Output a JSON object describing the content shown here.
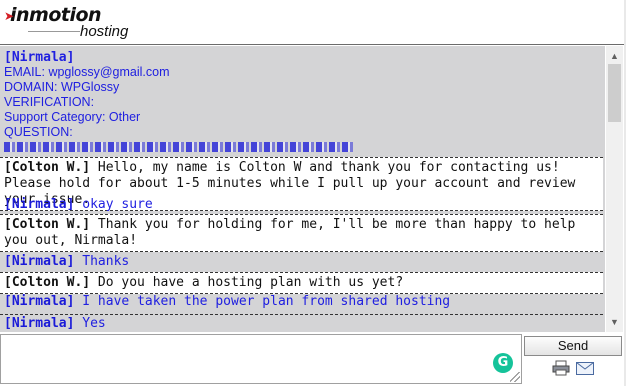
{
  "header": {
    "brand": "inmotion",
    "sub": "hosting"
  },
  "intro": {
    "who": "[Nirmala]",
    "email": "EMAIL: wpglossy@gmail.com",
    "domain": "DOMAIN: WPGlossy",
    "verification": "VERIFICATION:",
    "category": "Support Category: Other",
    "question_label": "QUESTION:"
  },
  "messages": [
    {
      "who": "[Colton W.]",
      "text": " Hello, my name is Colton W and thank you for contacting us! Please hold for about 1-5 minutes while I pull up your account and review your issue."
    },
    {
      "who": "[Nirmala]",
      "text": " okay sure"
    },
    {
      "who": "[Colton W.]",
      "text": " Thank you for holding for me, I'll be more than happy to help you out, Nirmala!"
    },
    {
      "who": "[Nirmala]",
      "text": " Thanks"
    },
    {
      "who": "[Colton W.]",
      "text": " Do you have a hosting plan with us yet?"
    },
    {
      "who": "[Nirmala]",
      "text": " I have taken the power plan from shared hosting"
    },
    {
      "who": "[Nirmala]",
      "text": " Yes"
    }
  ],
  "composer": {
    "send_label": "Send",
    "grammarly_label": "G"
  },
  "icons": {
    "print": "print-icon",
    "email": "mail-icon",
    "scroll_up": "chevron-up-icon",
    "scroll_down": "chevron-down-icon"
  }
}
